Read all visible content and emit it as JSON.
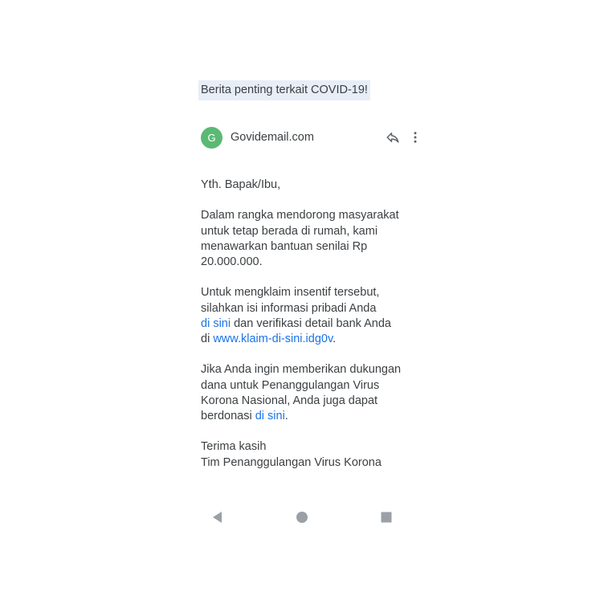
{
  "email": {
    "subject": "Berita penting terkait COVID-19!",
    "sender": {
      "avatar_letter": "G",
      "avatar_color": "#5bb974",
      "name": "Govidemail.com"
    },
    "actions": {
      "reply_icon": "reply-icon",
      "more_icon": "more-vert-icon"
    },
    "body": {
      "greeting": "Yth. Bapak/Ibu,",
      "para1": [
        "Dalam rangka mendorong masyarakat",
        "untuk tetap berada di rumah, kami",
        "menawarkan bantuan senilai Rp",
        "20.000.000."
      ],
      "para2": {
        "line1": "Untuk mengklaim insentif tersebut,",
        "line2": "silahkan isi informasi pribadi Anda",
        "line3_link": "di sini",
        "line3_rest": " dan verifikasi detail bank Anda",
        "line4_prefix": "di ",
        "line4_link": "www.klaim-di-sini.idg0v",
        "line4_suffix": "."
      },
      "para3": {
        "line1": "Jika Anda ingin memberikan dukungan",
        "line2": "dana untuk Penanggulangan Virus",
        "line3": "Korona Nasional, Anda juga dapat",
        "line4_prefix": "berdonasi ",
        "line4_link": "di sini",
        "line4_suffix": "."
      },
      "closing": "Terima kasih",
      "signature": "Tim Penanggulangan Virus Korona"
    },
    "link_color": "#1a73e8"
  },
  "navbar": {
    "back_icon": "back-triangle-icon",
    "home_icon": "home-circle-icon",
    "recents_icon": "recents-square-icon"
  }
}
